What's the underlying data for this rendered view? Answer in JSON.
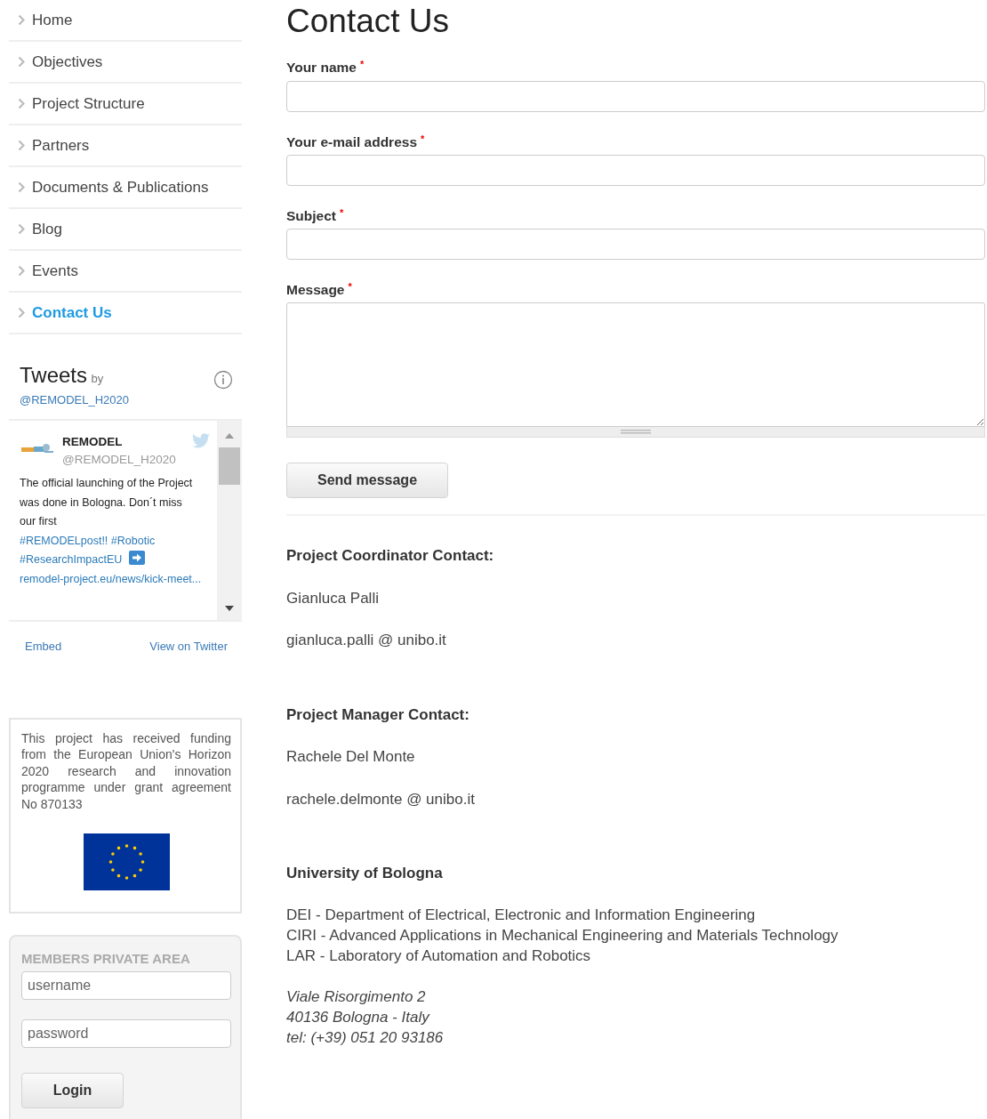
{
  "sidebar": {
    "items": [
      {
        "label": "Home",
        "selected": false
      },
      {
        "label": "Objectives",
        "selected": false
      },
      {
        "label": "Project Structure",
        "selected": false
      },
      {
        "label": "Partners",
        "selected": false
      },
      {
        "label": "Documents & Publications",
        "selected": false
      },
      {
        "label": "Blog",
        "selected": false
      },
      {
        "label": "Events",
        "selected": false
      },
      {
        "label": "Contact Us",
        "selected": true
      }
    ]
  },
  "tweets": {
    "title": "Tweets",
    "by": "by",
    "handle": "@REMODEL_H2020",
    "tweet": {
      "author": "REMODEL",
      "author_handle": "@REMODEL_H2020",
      "text": "The official launching of the Project was done in Bologna. Don´t miss our first",
      "hashtags": [
        "#REMODELpost!!",
        "#Robotic",
        "#ResearchImpactEU"
      ],
      "link": "remodel-project.eu/news/kick-meet..."
    },
    "footer_links": [
      "Embed",
      "View on Twitter"
    ]
  },
  "funding": {
    "text": "This project has received funding from the European Union's Horizon 2020 research and innovation programme under grant agreement No 870133"
  },
  "login": {
    "title": "MEMBERS PRIVATE AREA",
    "username_placeholder": "username",
    "password_placeholder": "password",
    "button": "Login"
  },
  "page_title": "Contact Us",
  "form": {
    "fields": [
      {
        "label": "Your name",
        "required_mark": "*",
        "kind": "input"
      },
      {
        "label": "Your e-mail address",
        "required_mark": "*",
        "kind": "input"
      },
      {
        "label": "Subject",
        "required_mark": "*",
        "kind": "input"
      },
      {
        "label": "Message",
        "required_mark": "*",
        "kind": "textarea"
      }
    ],
    "submit": "Send message"
  },
  "contacts": [
    {
      "heading": "Project Coordinator Contact:",
      "lines": [
        "Gianluca Palli",
        "gianluca.palli @ unibo.it"
      ]
    },
    {
      "heading": "Project Manager Contact:",
      "lines": [
        "Rachele Del Monte",
        "rachele.delmonte @ unibo.it"
      ]
    }
  ],
  "university": {
    "heading": "University of Bologna",
    "departments": [
      "DEI - Department of Electrical, Electronic and Information Engineering",
      "CIRI - Advanced Applications in Mechanical Engineering and Materials Technology",
      "LAR - Laboratory of Automation and Robotics"
    ],
    "address": [
      "Viale Risorgimento 2",
      "40136 Bologna - Italy",
      "tel: (+39) 051 20 93186"
    ]
  }
}
